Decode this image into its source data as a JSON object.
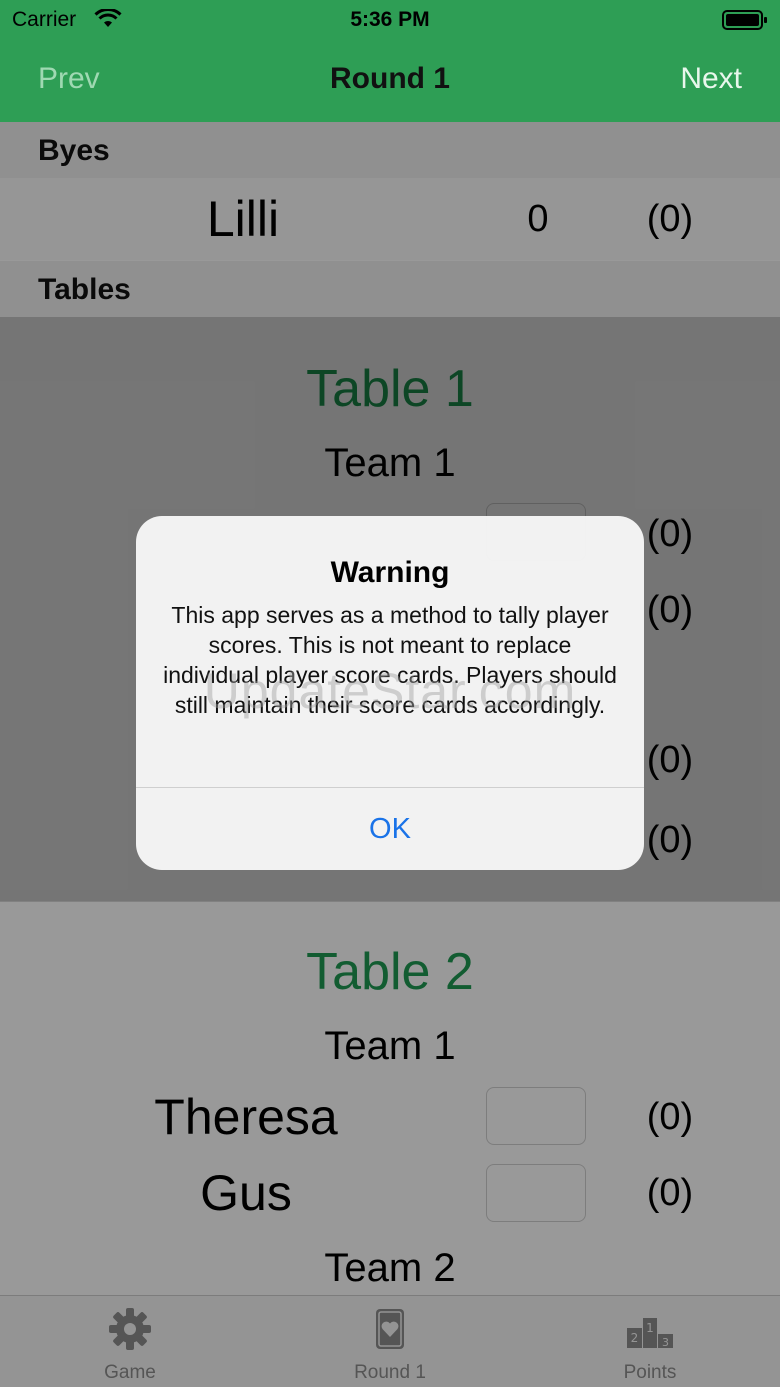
{
  "status_bar": {
    "carrier": "Carrier",
    "time": "5:36 PM"
  },
  "nav": {
    "prev_label": "Prev",
    "title": "Round 1",
    "next_label": "Next"
  },
  "byes": {
    "header": "Byes",
    "player": {
      "name": "Lilli",
      "score": "0",
      "total": "(0)"
    }
  },
  "tables_header": "Tables",
  "tables": [
    {
      "title": "Table 1",
      "team1_label": "Team 1",
      "totals": [
        "(0)",
        "(0)",
        "(0)",
        "(0)"
      ]
    },
    {
      "title": "Table 2",
      "team1_label": "Team 1",
      "players": [
        {
          "name": "Theresa",
          "total": "(0)"
        },
        {
          "name": "Gus",
          "total": "(0)"
        }
      ],
      "team2_label": "Team 2"
    }
  ],
  "tab_bar": [
    {
      "label": "Game",
      "icon": "gear-icon"
    },
    {
      "label": "Round 1",
      "icon": "playing-card-icon"
    },
    {
      "label": "Points",
      "icon": "podium-icon"
    }
  ],
  "alert": {
    "title": "Warning",
    "message": "This app serves as a method to tally player scores. This is not meant to replace individual player score cards. Players should still maintain their score cards accordingly.",
    "ok_label": "OK"
  },
  "watermark": "UpdateStar.com"
}
